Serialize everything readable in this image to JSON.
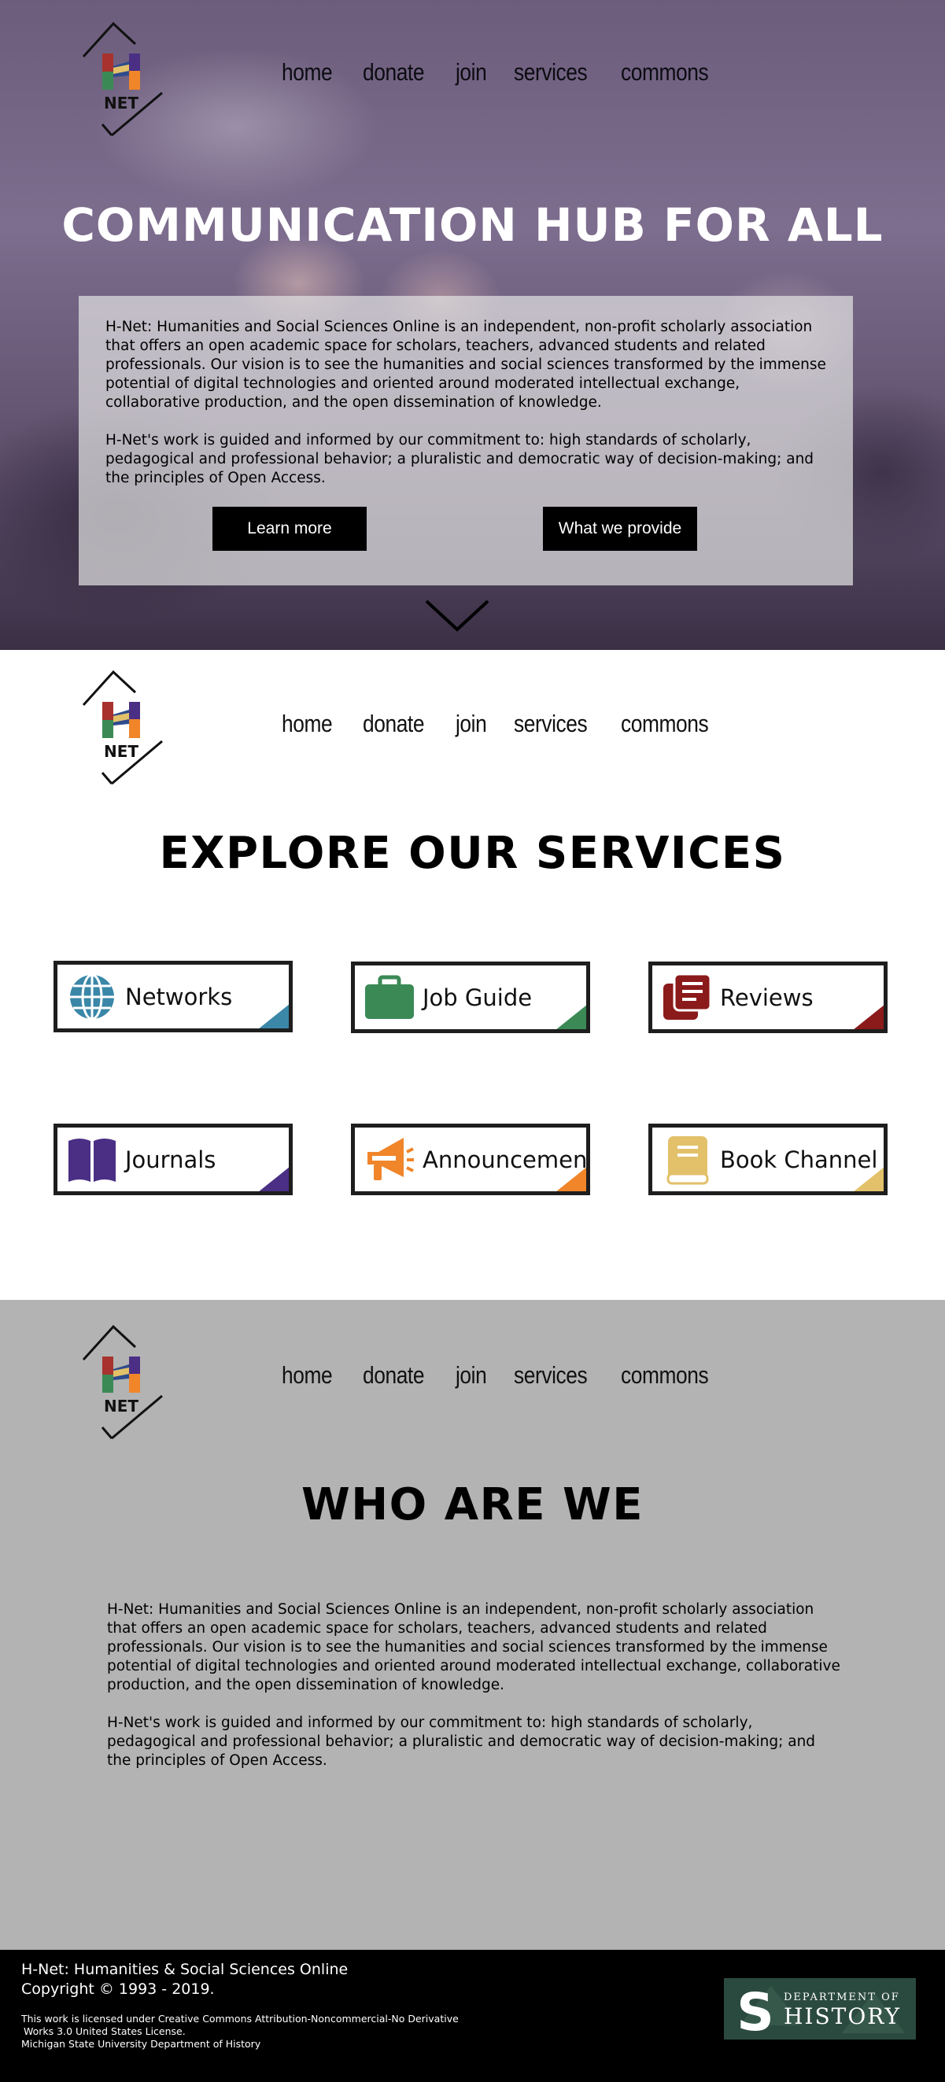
{
  "nav": [
    "home",
    "donate",
    "join",
    "services",
    "commons"
  ],
  "logo_text": "NET",
  "hero": {
    "title": "COMMUNICATION HUB FOR ALL",
    "paragraph1": "H-Net: Humanities and Social Sciences Online is an independent, non-profit scholarly association that offers an open academic space for scholars, teachers, advanced students and related professionals. Our vision is to see the humanities and social sciences transformed by the immense potential of digital technologies and oriented around moderated intellectual exchange, collaborative production, and the open dissemination of knowledge.",
    "paragraph2": "H-Net's work is guided and informed by our commitment to: high standards of scholarly, pedagogical and professional behavior; a pluralistic and democratic way of decision-making; and the principles of Open Access.",
    "learn_more_label": "Learn more",
    "what_we_provide_label": "What we provide"
  },
  "services": {
    "title": "EXPLORE OUR SERVICES",
    "cards": [
      {
        "label": "Networks",
        "icon": "globe-icon",
        "color": "#3a87a8"
      },
      {
        "label": "Job Guide",
        "icon": "briefcase-icon",
        "color": "#3b8a56"
      },
      {
        "label": "Reviews",
        "icon": "documents-icon",
        "color": "#8b1a1a"
      },
      {
        "label": "Journals",
        "icon": "open-book-icon",
        "color": "#4a2f84"
      },
      {
        "label": "Announcements",
        "icon": "megaphone-icon",
        "color": "#f0852a"
      },
      {
        "label": "Book Channel",
        "icon": "book-icon",
        "color": "#e2c16a"
      }
    ]
  },
  "who": {
    "title": "WHO ARE WE",
    "paragraph1": "H-Net: Humanities and Social Sciences Online is an independent, non-profit scholarly association that offers an open academic space for scholars, teachers, advanced students and related professionals. Our vision is to see the humanities and social sciences transformed by the immense potential of digital technologies and oriented around moderated intellectual exchange, collaborative production, and the open dissemination of knowledge.",
    "paragraph2": "H-Net's work is guided and informed by our commitment to: high standards of scholarly, pedagogical and professional behavior; a pluralistic and democratic way of decision-making; and the principles of Open Access."
  },
  "footer": {
    "org_name": "H-Net: Humanities & Social Sciences Online",
    "copyright": "Copyright © 1993 - 2019.",
    "license_line1": "This work is licensed under Creative Commons Attribution-Noncommercial-No Derivative",
    "license_line2": "Works 3.0 United States License.",
    "license_line3": "Michigan State University Department of History",
    "msu_logo_top": "DEPARTMENT OF",
    "msu_logo_bottom": "HISTORY",
    "msu_logo_letter": "S"
  },
  "colors": {
    "logo_red": "#a8322d",
    "logo_blue": "#2e4b8c",
    "logo_green": "#3b8a56",
    "logo_orange": "#f0852a",
    "logo_yellow": "#e2c16a",
    "logo_purple": "#4a2f84",
    "msu_green": "#2b4a3f"
  }
}
